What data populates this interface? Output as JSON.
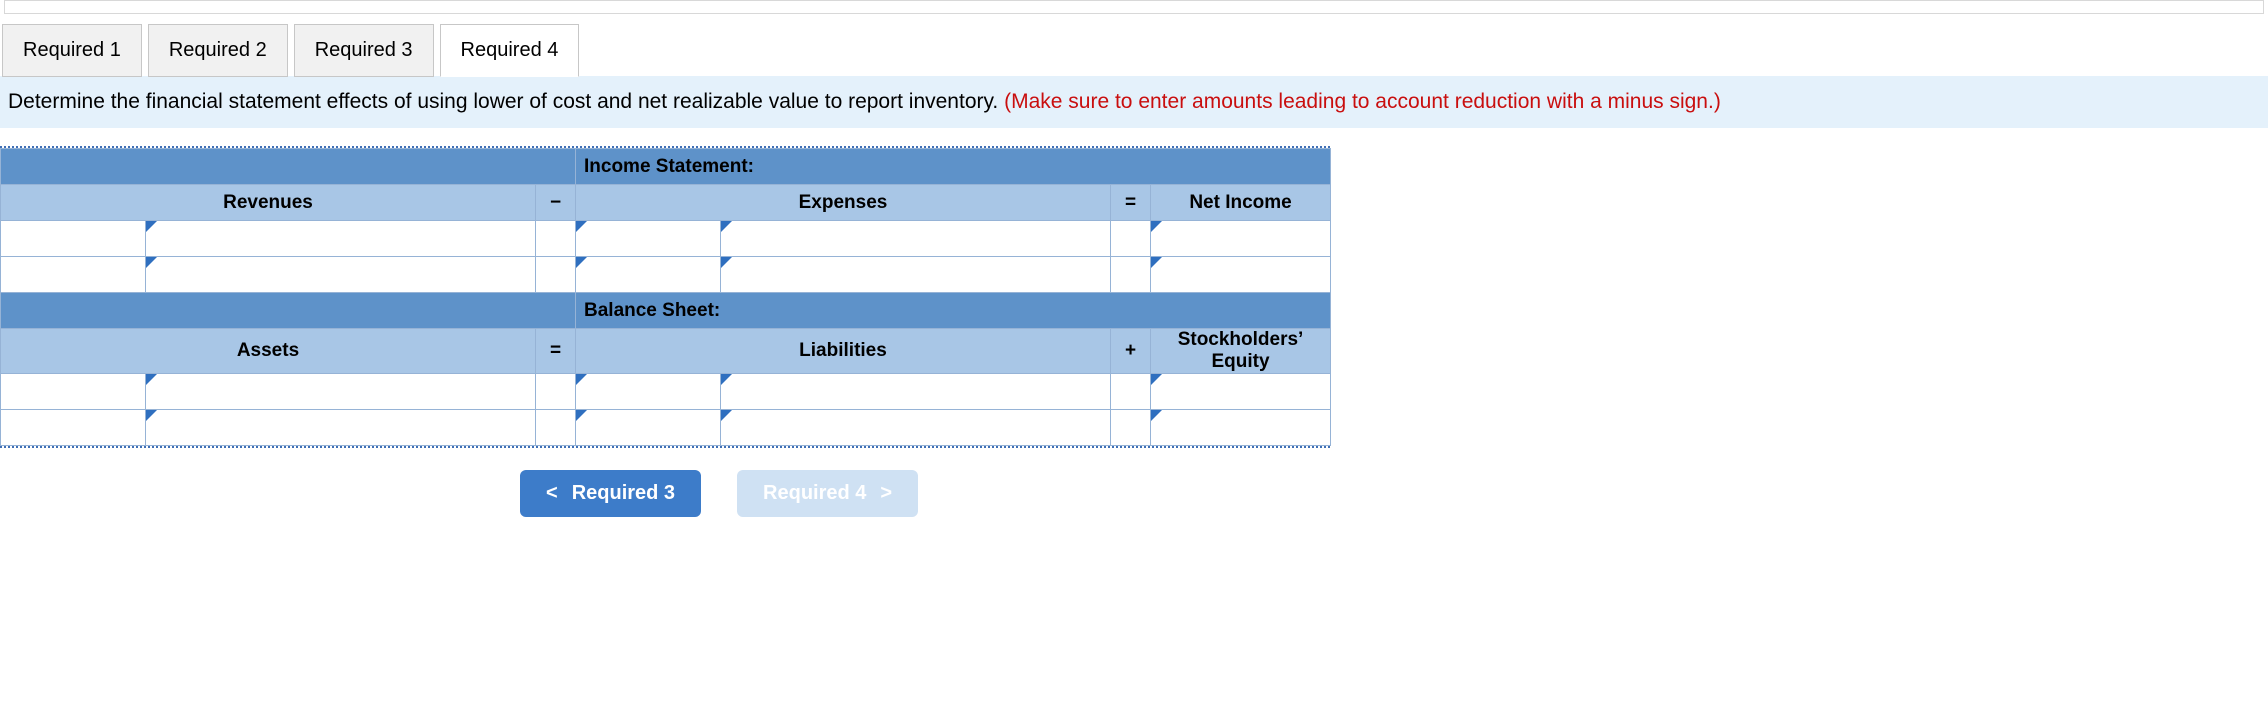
{
  "tabs": [
    "Required 1",
    "Required 2",
    "Required 3",
    "Required 4"
  ],
  "activeTab": 3,
  "instruction": {
    "black": "Determine the financial statement effects of using lower of cost and net realizable value to report inventory. ",
    "red": "(Make sure to enter amounts leading to account reduction with a minus sign.)"
  },
  "sections": {
    "income": {
      "title": "Income Statement:",
      "colA": "Revenues",
      "op1": "−",
      "colB": "Expenses",
      "op2": "=",
      "colC": "Net Income"
    },
    "balance": {
      "title": "Balance Sheet:",
      "colA": "Assets",
      "op1": "=",
      "colB": "Liabilities",
      "op2": "+",
      "colC": "Stockholders’ Equity"
    }
  },
  "navPrev": "Required 3",
  "navNext": "Required 4"
}
